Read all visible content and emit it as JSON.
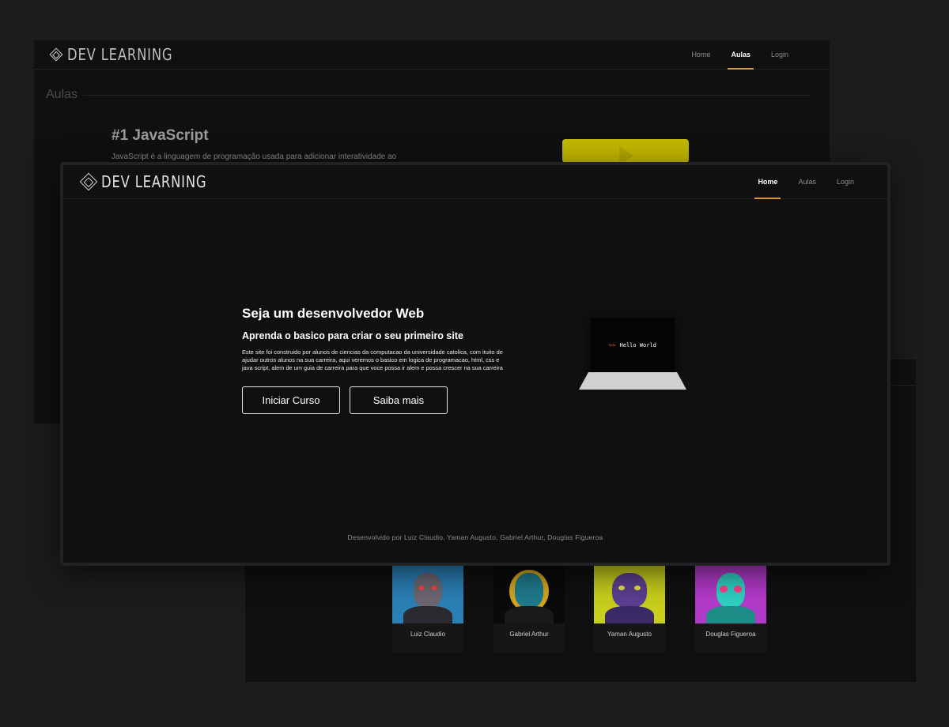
{
  "brand": "DEV LEARNING",
  "aulas_window": {
    "nav": [
      {
        "label": "Home",
        "active": false
      },
      {
        "label": "Aulas",
        "active": true
      },
      {
        "label": "Login",
        "active": false
      }
    ],
    "section_title": "Aulas",
    "lesson_title": "#1 JavaScript",
    "lesson_text": "JavaScript é a linguagem de programação usada para adicionar interatividade ao"
  },
  "home_window": {
    "nav": [
      {
        "label": "Home",
        "active": true
      },
      {
        "label": "Aulas",
        "active": false
      },
      {
        "label": "Login",
        "active": false
      }
    ],
    "hero": {
      "title": "Seja um desenvolvedor Web",
      "subtitle": "Aprenda o basico para criar o seu primeiro site",
      "description": "Este site foi construido por alunos de ciencias da computacao da universidade catolica, com ituito de ajudar outros alunos na sua carreira, aqui veremos o basico em logica de programacao, html, css e java script, alem de um guia de carreira para que voce possa ir alem e possa crescer na sua carreira",
      "primary_button": "Iniciar Curso",
      "secondary_button": "Saiba mais"
    },
    "laptop": {
      "prompt": ">>",
      "text": "Hello World"
    },
    "footer": "Desenvolvido por Luiz Claudio, Yaman Augusto, Gabriel Arthur, Douglas Figueroa"
  },
  "team": [
    {
      "name": "Luiz Claudio",
      "bg": "#2a7fb5",
      "accent": "#5a5560"
    },
    {
      "name": "Gabriel Arthur",
      "bg": "#0a0a0a",
      "accent": "#d4a51c"
    },
    {
      "name": "Yaman Augusto",
      "bg": "#c7cf1c",
      "accent": "#5a3f8f"
    },
    {
      "name": "Douglas Figueroa",
      "bg": "#b23ac8",
      "accent": "#2fd0c0"
    }
  ],
  "colors": {
    "accent": "#d79a3a",
    "background": "#1c1c1c",
    "window": "#101012"
  }
}
